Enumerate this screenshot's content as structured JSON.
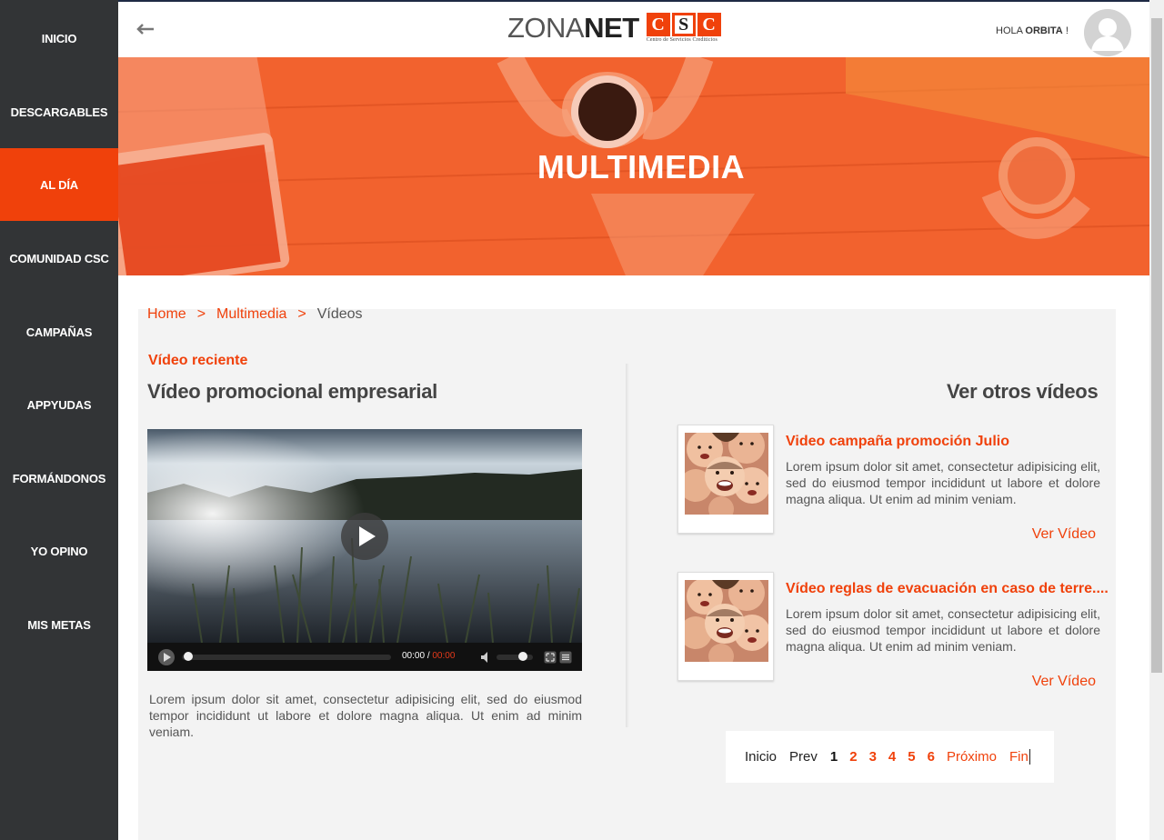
{
  "sidebar": {
    "items": [
      {
        "label": "INICIO"
      },
      {
        "label": "DESCARGABLES"
      },
      {
        "label": "AL DÍA",
        "active": true
      },
      {
        "label": "COMUNIDAD CSC"
      },
      {
        "label": "CAMPAÑAS"
      },
      {
        "label": "APPYUDAS"
      },
      {
        "label": "FORMÁNDONOS"
      },
      {
        "label": "YO OPINO"
      },
      {
        "label": "MIS METAS"
      }
    ]
  },
  "header": {
    "logo_zona": "ZONA",
    "logo_net": "NET",
    "logo_csc": [
      "C",
      "S",
      "C"
    ],
    "logo_sub": "Centro de Servicios Crediticios",
    "greeting_prefix": "HOLA ",
    "greeting_name": "ORBITA",
    "greeting_suffix": " !"
  },
  "banner": {
    "title": "MULTIMEDIA"
  },
  "breadcrumb": {
    "home": "Home",
    "sep": ">",
    "section": "Multimedia",
    "current": "Vídeos"
  },
  "main_video": {
    "section_label": "Vídeo reciente",
    "title": "Vídeo promocional empresarial",
    "time_current": "00:00",
    "time_sep": "/",
    "time_total": "00:00",
    "progress": 0,
    "volume": 0.8,
    "description": "Lorem ipsum dolor sit amet, consectetur adipisicing elit, sed do eiusmod tempor incididunt ut labore et dolore magna aliqua. Ut enim ad minim veniam."
  },
  "others": {
    "title": "Ver otros vídeos",
    "items": [
      {
        "title": "Video campaña promoción Julio",
        "text": "Lorem ipsum dolor sit amet, consectetur adipisicing elit, sed do eiusmod tempor incididunt ut labore et dolore magna aliqua. Ut enim ad minim veniam.",
        "link": "Ver Vídeo"
      },
      {
        "title": "Vídeo reglas de evacuación en caso de terre....",
        "text": "Lorem ipsum dolor sit amet, consectetur adipisicing elit, sed do eiusmod tempor incididunt ut labore et dolore magna aliqua. Ut enim ad minim veniam.",
        "link": "Ver Vídeo"
      }
    ]
  },
  "pagination": {
    "first": "Inicio",
    "prev": "Prev",
    "pages": [
      "1",
      "2",
      "3",
      "4",
      "5",
      "6"
    ],
    "current_page": "1",
    "next": "Próximo",
    "last": "Fin"
  },
  "colors": {
    "accent": "#f0410b",
    "sidebar": "#323436",
    "panel": "#f3f3f3"
  }
}
